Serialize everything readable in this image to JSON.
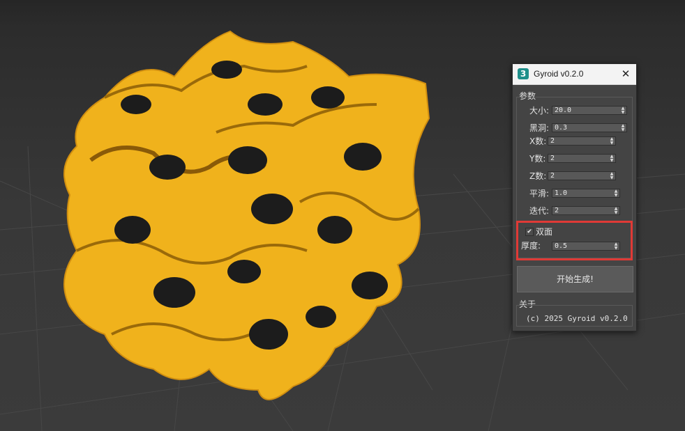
{
  "window": {
    "title": "Gyroid v0.2.0",
    "icon_glyph": "3",
    "icon_name": "3dsmax-app-icon",
    "close_glyph": "✕"
  },
  "params": {
    "group_label": "参数",
    "size": {
      "label": "大小:",
      "value": "20.0"
    },
    "hole": {
      "label": "黑洞:",
      "value": "0.3"
    },
    "x_count": {
      "label": "X数:",
      "value": "2"
    },
    "y_count": {
      "label": "Y数:",
      "value": "2"
    },
    "z_count": {
      "label": "Z数:",
      "value": "2"
    },
    "smooth": {
      "label": "平滑:",
      "value": "1.0"
    },
    "iterations": {
      "label": "迭代:",
      "value": "2"
    },
    "double_sided": {
      "label": "双面",
      "checked": true,
      "check_glyph": "✔"
    },
    "thickness": {
      "label": "厚度:",
      "value": "0.5"
    }
  },
  "generate_button": {
    "label": "开始生成!"
  },
  "about": {
    "group_label": "关于",
    "text": "(c) 2025 Gyroid v0.2.0"
  },
  "colors": {
    "viewport_bg": "#333333",
    "gyroid": "#f0b21c",
    "highlight": "#e03a36",
    "dialog_bg": "#444444"
  }
}
